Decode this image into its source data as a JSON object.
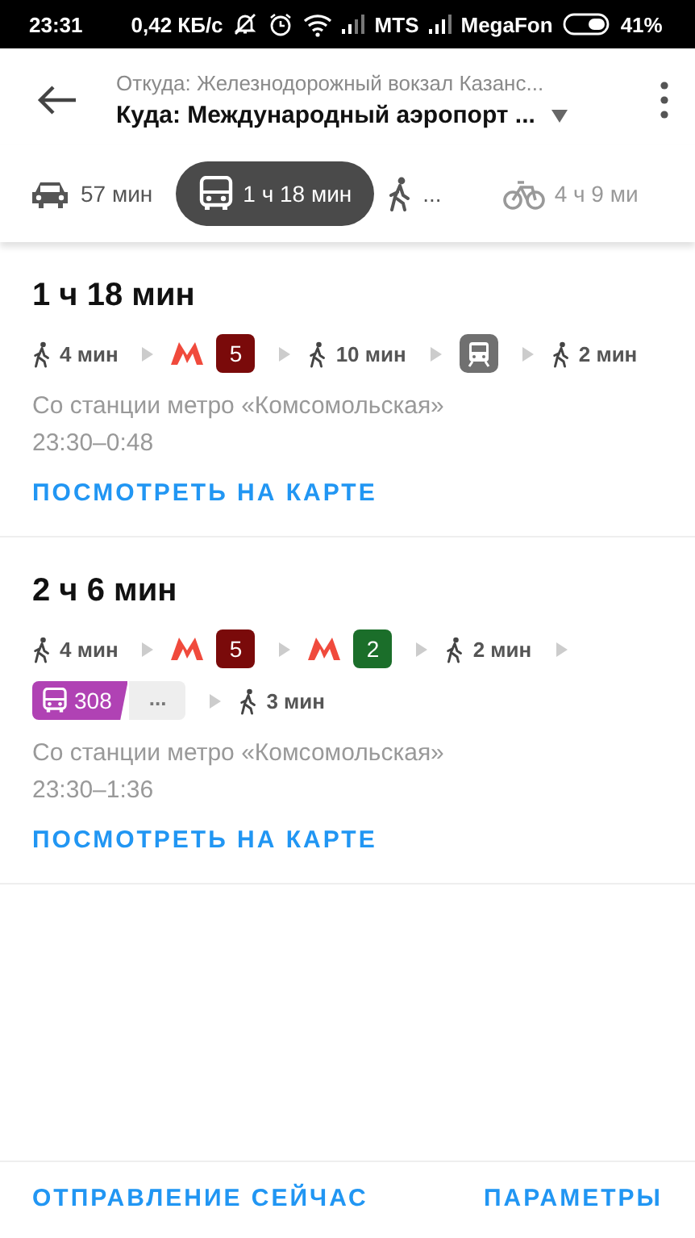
{
  "status_bar": {
    "time": "23:31",
    "speed": "0,42 КБ/с",
    "carriers": [
      "MTS",
      "MegaFon"
    ],
    "battery": "41%"
  },
  "header": {
    "from": "Откуда: Железнодорожный вокзал Казанс...",
    "to": "Куда: Международный аэропорт ..."
  },
  "modes": [
    {
      "kind": "car",
      "label": "57 мин",
      "selected": false
    },
    {
      "kind": "transit",
      "label": "1 ч 18 мин",
      "selected": true
    },
    {
      "kind": "walk",
      "label": "...",
      "selected": false
    },
    {
      "kind": "bike",
      "label": "4 ч 9 ми",
      "selected": false
    }
  ],
  "routes": [
    {
      "duration": "1 ч 18 мин",
      "steps": [
        {
          "kind": "walk",
          "label": "4 мин"
        },
        {
          "kind": "metro",
          "line": "5",
          "color": "#7a0a0a"
        },
        {
          "kind": "walk",
          "label": "10 мин"
        },
        {
          "kind": "train"
        },
        {
          "kind": "walk",
          "label": "2 мин"
        }
      ],
      "station": "Со станции метро «Комсомольская»",
      "times": "23:30–0:48",
      "link": "ПОСМОТРЕТЬ НА КАРТЕ"
    },
    {
      "duration": "2 ч 6 мин",
      "steps": [
        {
          "kind": "walk",
          "label": "4 мин"
        },
        {
          "kind": "metro",
          "line": "5",
          "color": "#7a0a0a"
        },
        {
          "kind": "metro",
          "line": "2",
          "color": "#1b6e2a"
        },
        {
          "kind": "walk",
          "label": "2 мин"
        },
        {
          "kind": "bus",
          "label": "308",
          "color": "#b042b4",
          "more": "..."
        },
        {
          "kind": "walk",
          "label": "3 мин"
        }
      ],
      "station": "Со станции метро «Комсомольская»",
      "times": "23:30–1:36",
      "link": "ПОСМОТРЕТЬ НА КАРТЕ"
    }
  ],
  "footer": {
    "depart": "ОТПРАВЛЕНИЕ СЕЙЧАС",
    "params": "ПАРАМЕТРЫ"
  }
}
